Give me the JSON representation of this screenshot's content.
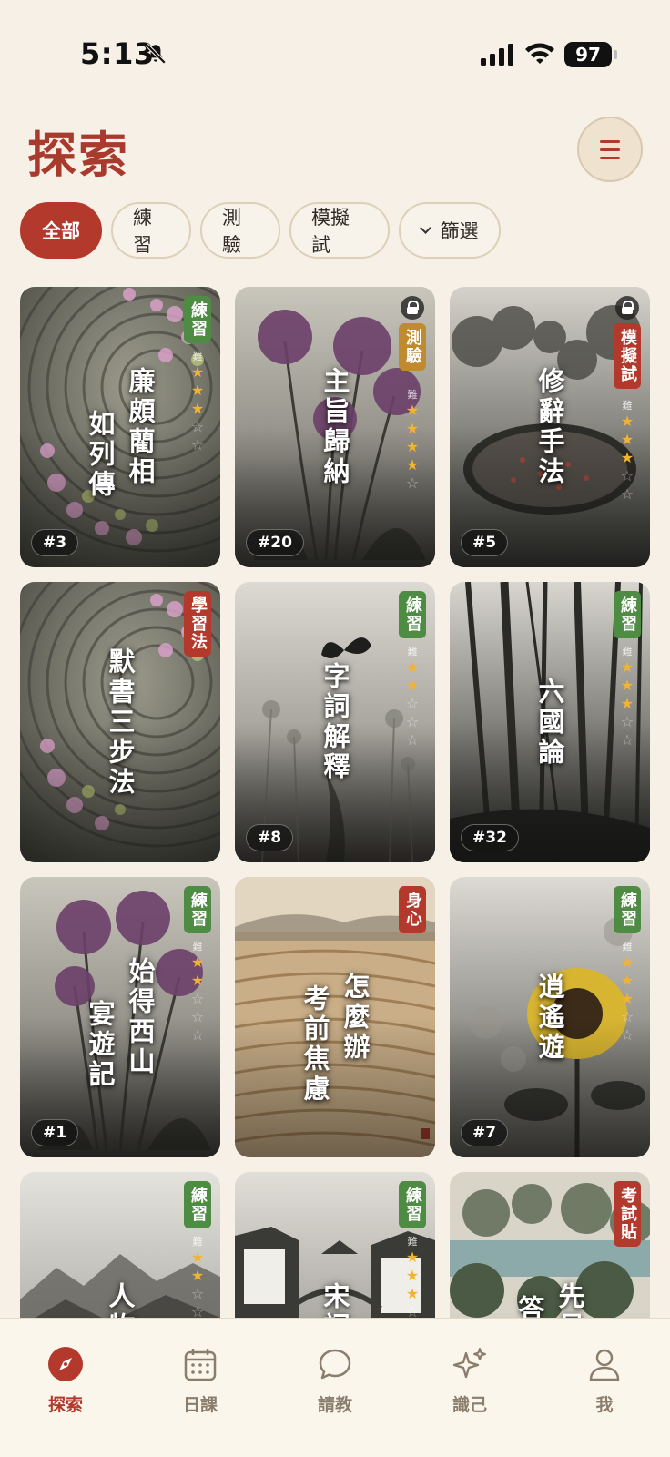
{
  "status": {
    "time": "5:13",
    "battery": "97"
  },
  "header": {
    "title": "探索"
  },
  "filters": [
    {
      "label": "全部",
      "active": true
    },
    {
      "label": "練習",
      "active": false
    },
    {
      "label": "測驗",
      "active": false
    },
    {
      "label": "模擬試",
      "active": false
    },
    {
      "label": "篩選",
      "active": false
    }
  ],
  "difficulty_label": "難",
  "cards": [
    {
      "title_lines": [
        "如列傳",
        "廉頗藺相"
      ],
      "tag": "練習",
      "tag_color": "#4e8b43",
      "stars": 3,
      "number": "#3",
      "locked": false,
      "image": "allium-spiral"
    },
    {
      "title_lines": [
        "主旨歸納"
      ],
      "tag": "測驗",
      "tag_color": "#c08a2e",
      "stars": 4,
      "number": "#20",
      "locked": true,
      "image": "allium"
    },
    {
      "title_lines": [
        "修辭手法"
      ],
      "tag": "模擬試",
      "tag_color": "#b2392c",
      "stars": 3,
      "number": "#5",
      "locked": true,
      "image": "garden-pond"
    },
    {
      "title_lines": [
        "默書三步法"
      ],
      "tag": "學習法",
      "tag_color": "#b2392c",
      "stars": null,
      "number": "",
      "locked": false,
      "image": "allium-spiral"
    },
    {
      "title_lines": [
        "字詞解釋"
      ],
      "tag": "練習",
      "tag_color": "#4e8b43",
      "stars": 2,
      "number": "#8",
      "locked": false,
      "image": "butterfly-field"
    },
    {
      "title_lines": [
        "六國論"
      ],
      "tag": "練習",
      "tag_color": "#4e8b43",
      "stars": 3,
      "number": "#32",
      "locked": false,
      "image": "forest"
    },
    {
      "title_lines": [
        "宴遊記",
        "始得西山"
      ],
      "tag": "練習",
      "tag_color": "#4e8b43",
      "stars": 2,
      "number": "#1",
      "locked": false,
      "image": "allium"
    },
    {
      "title_lines": [
        "怎麼辦",
        "考前焦慮"
      ],
      "tag": "身心",
      "tag_color": "#b2392c",
      "stars": null,
      "number": "",
      "locked": false,
      "image": "terraced-fields"
    },
    {
      "title_lines": [
        "逍遙遊"
      ],
      "tag": "練習",
      "tag_color": "#4e8b43",
      "stars": 3,
      "number": "#7",
      "locked": false,
      "image": "sunflower"
    },
    {
      "title_lines": [
        "人物"
      ],
      "tag": "練習",
      "tag_color": "#4e8b43",
      "stars": 2,
      "number": "",
      "locked": false,
      "image": "mountains"
    },
    {
      "title_lines": [
        "宋詞"
      ],
      "tag": "練習",
      "tag_color": "#4e8b43",
      "stars": 3,
      "number": "",
      "locked": false,
      "image": "village"
    },
    {
      "title_lines": [
        "先易",
        "答題策"
      ],
      "tag": "考試貼",
      "tag_color": "#b2392c",
      "stars": null,
      "number": "",
      "locked": false,
      "image": "lake-trees"
    }
  ],
  "tabbar": [
    {
      "label": "探索",
      "icon": "compass-icon",
      "active": true
    },
    {
      "label": "日課",
      "icon": "calendar-icon",
      "active": false
    },
    {
      "label": "請教",
      "icon": "chat-icon",
      "active": false
    },
    {
      "label": "識己",
      "icon": "sparkles-icon",
      "active": false
    },
    {
      "label": "我",
      "icon": "person-icon",
      "active": false
    }
  ],
  "colors": {
    "accent": "#b2392c",
    "background": "#f6f0e6",
    "practice_green": "#4e8b43",
    "quiz_gold": "#c08a2e"
  }
}
